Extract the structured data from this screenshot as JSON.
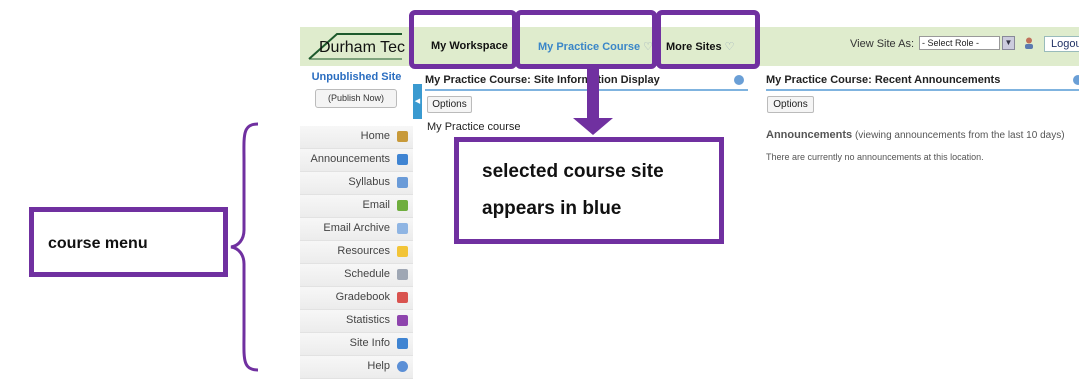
{
  "header": {
    "logo_text": "Durham Tec",
    "tabs": [
      {
        "label": "My Workspace",
        "chevron": ""
      },
      {
        "label": "My Practice Course",
        "chevron": "♡"
      },
      {
        "label": "More Sites",
        "chevron": "♡"
      }
    ],
    "view_site_as_label": "View Site As:",
    "role_select_value": "- Select Role -",
    "logout_label": "Logou"
  },
  "sidebar": {
    "status": "Unpublished Site",
    "publish_button": "(Publish Now)",
    "items": [
      {
        "label": "Home",
        "icon": "home-icon",
        "color": "#c89a3a"
      },
      {
        "label": "Announcements",
        "icon": "megaphone-icon",
        "color": "#3f84d2"
      },
      {
        "label": "Syllabus",
        "icon": "document-icon",
        "color": "#6a9bd8"
      },
      {
        "label": "Email",
        "icon": "email-icon",
        "color": "#6fae3e"
      },
      {
        "label": "Email Archive",
        "icon": "envelope-icon",
        "color": "#8fb5e3"
      },
      {
        "label": "Resources",
        "icon": "folder-icon",
        "color": "#f2c437"
      },
      {
        "label": "Schedule",
        "icon": "calendar-icon",
        "color": "#9fa7b4"
      },
      {
        "label": "Gradebook",
        "icon": "gradebook-icon",
        "color": "#d9534f"
      },
      {
        "label": "Statistics",
        "icon": "bar-chart-icon",
        "color": "#8e44ad"
      },
      {
        "label": "Site Info",
        "icon": "info-icon",
        "color": "#3f84d2"
      },
      {
        "label": "Help",
        "icon": "help-icon",
        "color": "#5b8fd6"
      }
    ]
  },
  "panel_left": {
    "title": "My Practice Course: Site Information Display",
    "options_label": "Options",
    "description": "My Practice course"
  },
  "panel_right": {
    "title": "My Practice Course: Recent Announcements",
    "options_label": "Options",
    "announcements_heading": "Announcements",
    "announcements_note": "(viewing announcements from the last 10 days)",
    "empty_message": "There are currently no announcements at this location."
  },
  "annotations": {
    "course_callout_line1": "selected course site",
    "course_callout_line2": "appears in blue",
    "menu_callout": "course menu"
  },
  "colors": {
    "annotation_purple": "#7030a0",
    "selected_tab_blue": "#3a86c8",
    "topbar_green": "#dfeccd"
  }
}
